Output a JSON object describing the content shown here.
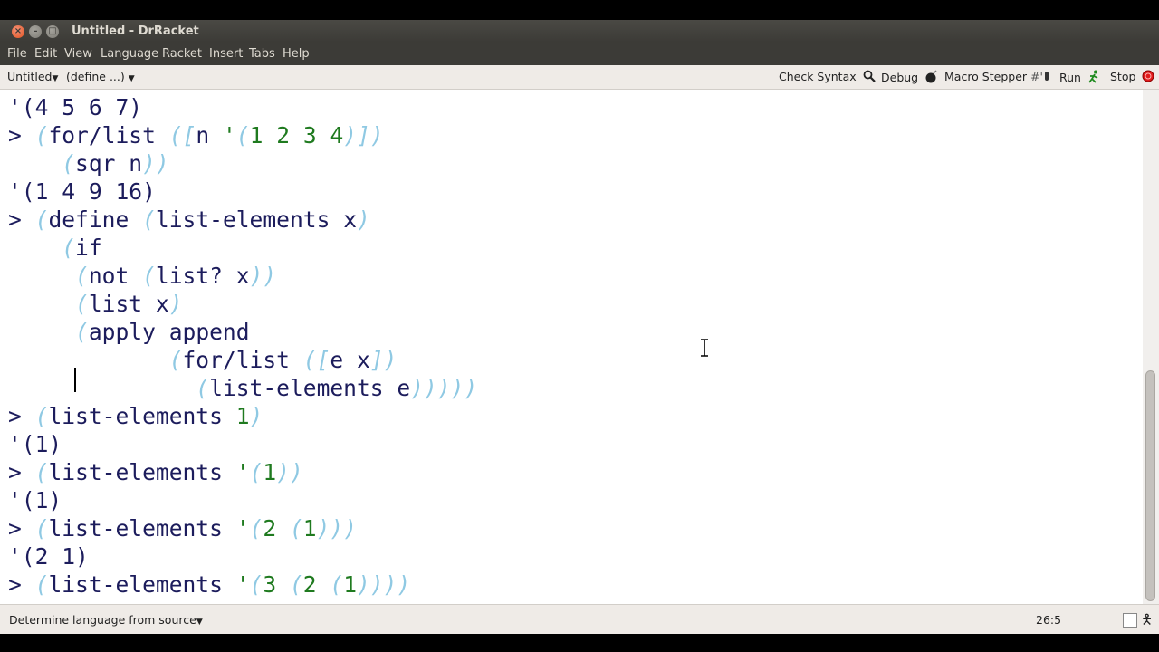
{
  "window": {
    "title": "Untitled - DrRacket"
  },
  "menubar": {
    "items": [
      "File",
      "Edit",
      "View",
      "Language",
      "Racket",
      "Insert",
      "Tabs",
      "Help"
    ]
  },
  "toolbar": {
    "file_menu": "Untitled",
    "define_menu": "(define ...)",
    "check_syntax": "Check Syntax",
    "debug": "Debug",
    "macro_stepper": "Macro Stepper",
    "macro_stepper_glyph": "#'",
    "run": "Run",
    "stop": "Stop"
  },
  "interactions": {
    "lines": [
      "'(4 5 6 7)",
      "> (for/list ([n '(1 2 3 4)])",
      "    (sqr n))",
      "'(1 4 9 16)",
      "> (define (list-elements x)",
      "    (if",
      "     (not (list? x))",
      "     (list x)",
      "     (apply append",
      "            (for/list ([e x])",
      "              (list-elements e)))))",
      "> (list-elements 1)",
      "'(1)",
      "> (list-elements '(1))",
      "'(1)",
      "> (list-elements '(2 (1)))",
      "'(2 1)",
      "> (list-elements '(3 (2 (1))))"
    ]
  },
  "statusbar": {
    "language": "Determine language from source",
    "position": "26:5"
  },
  "colors": {
    "text": "#1c1c5c",
    "paren": "#8fc9e3",
    "constant": "#1f7a1f",
    "stop_red": "#e11b1b"
  }
}
